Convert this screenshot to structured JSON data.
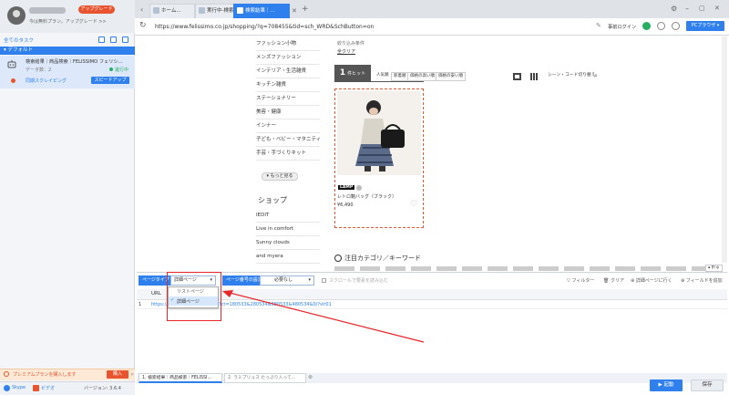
{
  "sidebar": {
    "upgrade_label": "アップグレード",
    "plan_text": "今は無料プラン，アップグレード >>",
    "all_tasks": "全てのタスク",
    "folder_default": "デフォルト",
    "task_title": "検索結果｜商品検索｜FELISSIMO フェリシ...",
    "task_data": "データ数：2",
    "task_status": "進行中",
    "task_mode": "同期スクレイピング",
    "speedup_label": "スピードアップ",
    "premium_text": "プレミアムプランを購入します",
    "buy_label": "購入",
    "skype_label": "Skype",
    "email_label": "ビデオ",
    "version": "バージョン: 3.6.4"
  },
  "browser": {
    "tabs": [
      {
        "label": "ホーム..."
      },
      {
        "label": "実行中-検索..."
      },
      {
        "label": "検索結果｜..."
      }
    ],
    "url": "https://www.felissimo.co.jp/shopping/?q=708455&tid=sch_WRD&SchButton=on",
    "login_label": "事前ログイン",
    "pc_browser_label": "PCブラウザ"
  },
  "page": {
    "filter_title": "絞り込み条件",
    "clear_label": "全クリア",
    "categories": [
      "ファッション小物",
      "メンズファッション",
      "インテリア・生活雑貨",
      "キッチン雑貨",
      "ステーショナリー",
      "美容・健康",
      "インナー",
      "子ども・ベビー・マタニティ",
      "手芸・手づくりキット"
    ],
    "more_label": "▾ もっと見る",
    "shop_heading": "ショップ",
    "shops": [
      "IEDIT",
      "Live in comfort",
      "Sunny clouds",
      "and myera"
    ],
    "hit_count": "1",
    "hit_suffix": "件ヒット",
    "sort_options": [
      "人気順",
      "新着順",
      "価格の高い順",
      "価格の安い順"
    ],
    "scene_label": "シーン・コード切り替え",
    "product_brand": "LAMP",
    "product_name": "レトロ鞄バッグ（ブラック）",
    "product_price": "¥6,490",
    "attention_heading": "注目カテゴリ／キーワード"
  },
  "workspace": {
    "page_type_label": "ページタイプ",
    "page_type_value": "詳細ページ",
    "page_number_label": "ページ番号の設定",
    "page_number_value": "必要なし",
    "scroll_label": "スクロールで要素を読み込む",
    "filter_label": "フィルター",
    "clear_label": "クリア",
    "detail_label": "詳細ページに行く",
    "add_field_label": "フィールドを追加",
    "fold_label": "折る",
    "dropdown_options": [
      "リストページ",
      "詳細ページ"
    ],
    "column_header": "URL",
    "row_index": "1",
    "row_url_start": "https://www.",
    "row_url_end": "?ct=180533&280534&380533&480534&0/?vlr01",
    "footer_tabs": [
      "1. 検索結果｜商品検索｜FELISSI...",
      "2. ラミプリュス たっぷり入って..."
    ],
    "start_label": "▶ 起動",
    "save_label": "保存"
  }
}
